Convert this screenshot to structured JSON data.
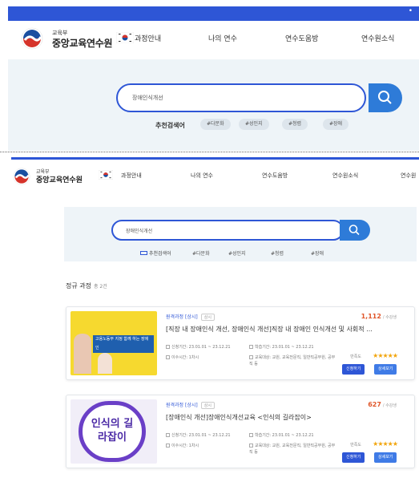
{
  "panel1": {
    "logo_small": "교육부",
    "logo_big": "중앙교육연수원",
    "nav": [
      "과정안내",
      "나의 연수",
      "연수도움방",
      "연수원소식"
    ],
    "search_value": "장애인식개선",
    "recommend_label": "추천검색어",
    "chips": [
      "#다문화",
      "#성인지",
      "#청렴",
      "#장애"
    ]
  },
  "panel2": {
    "logo_small": "교육부",
    "logo_big": "중앙교육연수원",
    "nav": [
      "과정안내",
      "나의 연수",
      "연수도움방",
      "연수원소식",
      "연수원"
    ],
    "search_value": "장애인식개선",
    "recommend_label": "추천검색어",
    "chips": [
      "#다문화",
      "#성인지",
      "#청렴",
      "#장애"
    ],
    "section_title": "정규 과정",
    "section_count": "총 2건",
    "courses": [
      {
        "tag": "원격과정 [상시]",
        "tag2": "상시",
        "title": "[직장 내 장애인식 개선, 장애인식 개선]직장 내 장애인 인식개선 및 사회적 ...",
        "count": "1,112",
        "count_unit": "/ 수강생",
        "period": "신청기간: 23.01.01 ~ 23.12.21",
        "hours": "학습기간: 23.01.01 ~ 23.12.21",
        "credit": "이수시간: 1차시",
        "target": "교육대상: 교원, 교육전문직, 일반직공무원, 공무직 등",
        "rating_label": "만족도",
        "stars": "★★★★★",
        "btn_apply": "신청하기",
        "btn_detail": "상세보기",
        "thumb_text": "고용노동부 지정 함께 하는 장애인"
      },
      {
        "tag": "원격과정 [상시]",
        "tag2": "상시",
        "title": "[장애인식 개선]장애인식개선교육 <인식의 길라잡이>",
        "count": "627",
        "count_unit": "/ 수강생",
        "period": "신청기간: 23.01.01 ~ 23.12.21",
        "hours": "학습기간: 23.01.01 ~ 23.12.21",
        "credit": "이수시간: 1차시",
        "target": "교육대상: 교원, 교육전문직, 일반직공무원, 공무직 등",
        "rating_label": "만족도",
        "stars": "★★★★★",
        "btn_apply": "신청하기",
        "btn_detail": "상세보기",
        "thumb_text": "인식의 길라잡이"
      }
    ]
  }
}
